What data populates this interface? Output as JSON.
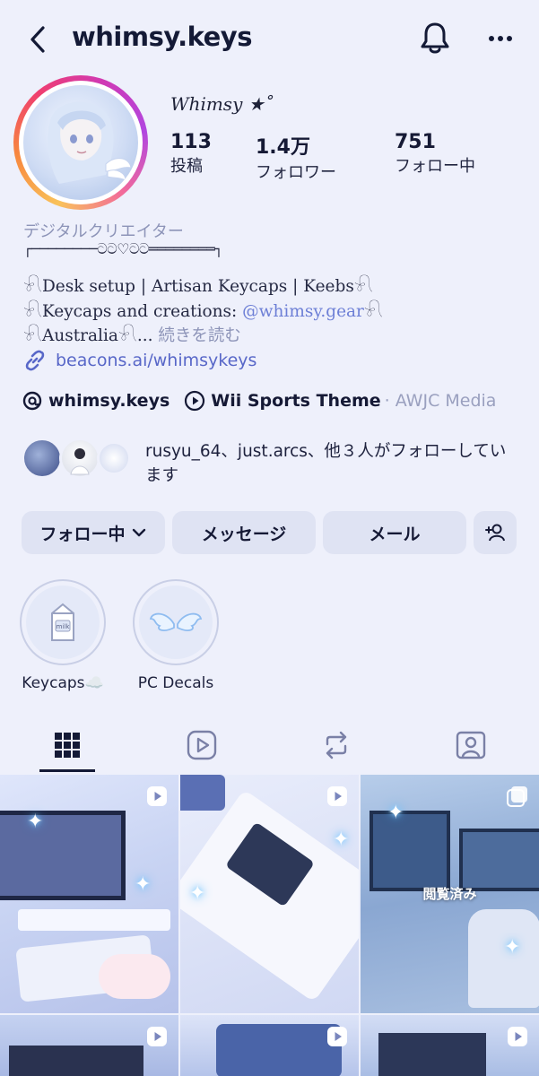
{
  "header": {
    "username": "whimsy.keys",
    "icons": {
      "back": "chevron-left-icon",
      "notifications": "bell-icon",
      "more": "more-horizontal-icon"
    }
  },
  "profile": {
    "display_name": "𝑊ℎ𝑖𝑚𝑠𝑦 ★˚",
    "stats": [
      {
        "value": "113",
        "label": "投稿"
      },
      {
        "value": "1.4万",
        "label": "フォロワー"
      },
      {
        "value": "751",
        "label": "フォロー中"
      }
    ],
    "category": "デジタルクリエイター",
    "bio": {
      "divider": "┌────────ටට♡ටට════════┐",
      "line1": "𓍯Desk setup | Artisan Keycaps | Keebs𓍯",
      "line2_prefix": "𓍯Keycaps and creations: ",
      "line2_mention": "@whimsy.gear",
      "line2_suffix": "𓍯",
      "line3_prefix": "𓍯Australia𓍯... ",
      "read_more": "続きを読む"
    },
    "link": "beacons.ai/whimsykeys",
    "threads_handle": "whimsy.keys",
    "music_title": "Wii Sports Theme",
    "music_artist": "· AWJC Media",
    "followed_by": "rusyu_64、just.arcs、他３人がフォローしています"
  },
  "actions": {
    "following": "フォロー中",
    "message": "メッセージ",
    "email": "メール"
  },
  "highlights": [
    {
      "label": "Keycaps☁️"
    },
    {
      "label": "PC Decals"
    }
  ],
  "tabs": [
    "grid-icon",
    "reels-icon",
    "reposts-icon",
    "tagged-icon"
  ],
  "grid": {
    "seen_label": "閲覧済み"
  },
  "colors": {
    "background": "#eef0fb",
    "accent_link": "#5867c8",
    "button_bg": "#dfe3f3"
  }
}
